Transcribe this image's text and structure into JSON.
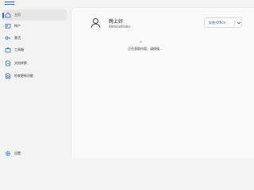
{
  "sidebar": {
    "items": [
      {
        "label": "主页",
        "icon": "home-icon",
        "active": true
      },
      {
        "label": "帐户",
        "icon": "account-icon",
        "active": false
      },
      {
        "label": "激活",
        "icon": "key-icon",
        "active": false
      },
      {
        "label": "工具箱",
        "icon": "toolbox-icon",
        "active": false
      },
      {
        "label": "文档转换",
        "icon": "document-convert-icon",
        "active": false
      },
      {
        "label": "检查更新功能",
        "icon": "update-document-icon",
        "active": false
      }
    ],
    "settings_label": "设置"
  },
  "main": {
    "greeting": "晚上好",
    "username": "Administrator",
    "install_button_label": "安装 Office",
    "loading_text": "正在获取内容，请稍候…"
  },
  "colors": {
    "accent": "#2b66c4",
    "background": "#f3f3f3",
    "panel": "#fafafa"
  }
}
